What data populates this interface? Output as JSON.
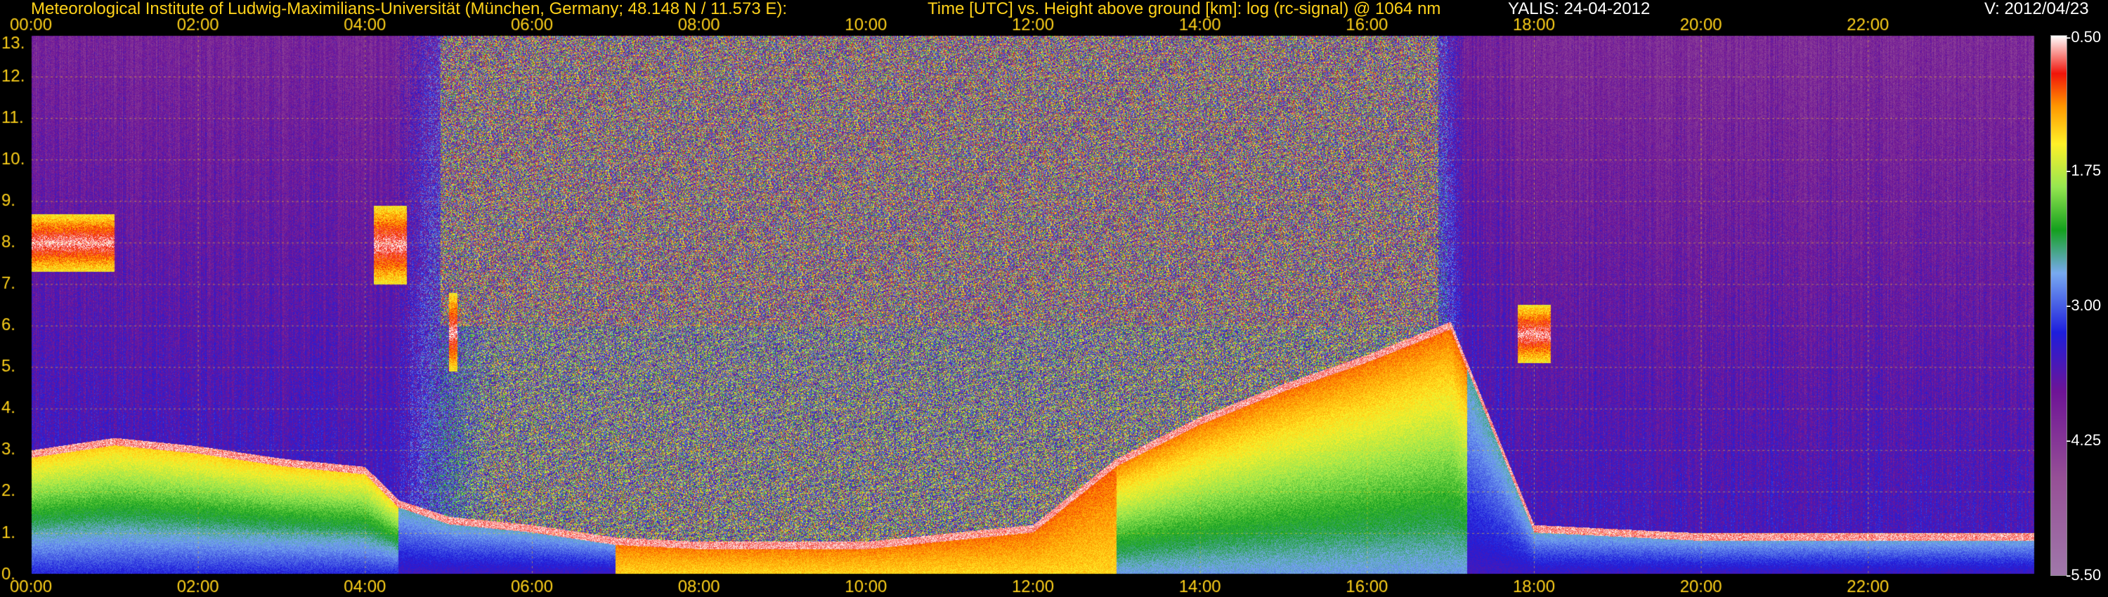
{
  "header": {
    "institute": "Meteorological Institute of Ludwig-Maximilians-Universität (München, Germany; 48.148 N / 11.573 E):",
    "plot_title": "Time [UTC] vs. Height above ground [km]: log (rc-signal) @ 1064 nm",
    "instrument_date": "YALIS: 24-04-2012",
    "version": "V: 2012/04/23"
  },
  "colorbar": {
    "labels": [
      "-0.50",
      "-1.75",
      "-3.00",
      "-4.25",
      "-5.50"
    ],
    "range": [
      -5.5,
      -0.5
    ]
  },
  "chart_data": {
    "type": "heatmap",
    "title": "Time [UTC] vs. Height above ground [km]: log (rc-signal) @ 1064 nm",
    "xlabel": "Time [UTC]",
    "ylabel": "Height above ground [km]",
    "x_ticks": [
      "00:00",
      "02:00",
      "04:00",
      "06:00",
      "08:00",
      "10:00",
      "12:00",
      "14:00",
      "16:00",
      "18:00",
      "20:00",
      "22:00"
    ],
    "y_ticks": [
      "0.",
      "1.",
      "2.",
      "3.",
      "4.",
      "5.",
      "6.",
      "7.",
      "8.",
      "9.",
      "10.",
      "11.",
      "12.",
      "13."
    ],
    "xlim_hours": [
      0,
      24
    ],
    "ylim_km": [
      0,
      13
    ],
    "color_range": [
      -5.5,
      -0.5
    ],
    "grid": true,
    "features": [
      {
        "name": "boundary layer top",
        "hours": [
          0,
          1,
          2,
          3,
          4,
          4.4,
          5,
          6,
          7,
          8,
          10,
          12,
          13,
          14,
          15,
          16,
          17,
          18,
          20,
          22,
          24
        ],
        "height_km": [
          3.0,
          3.3,
          3.1,
          2.8,
          2.6,
          1.8,
          1.4,
          1.2,
          0.9,
          0.8,
          0.8,
          1.2,
          2.8,
          3.8,
          4.6,
          5.3,
          6.1,
          1.2,
          1.0,
          1.0,
          1.0
        ]
      },
      {
        "name": "cloud layer",
        "hours": [
          0,
          1
        ],
        "base_km": 7.3,
        "top_km": 8.7
      },
      {
        "name": "cloud layer",
        "hours": [
          4.1,
          4.5
        ],
        "base_km": 7.0,
        "top_km": 8.9
      },
      {
        "name": "cloud layer",
        "hours": [
          5.0,
          5.1
        ],
        "base_km": 4.9,
        "top_km": 6.8
      },
      {
        "name": "cloud layer",
        "hours": [
          17.8,
          18.2
        ],
        "base_km": 5.1,
        "top_km": 6.5
      }
    ]
  }
}
